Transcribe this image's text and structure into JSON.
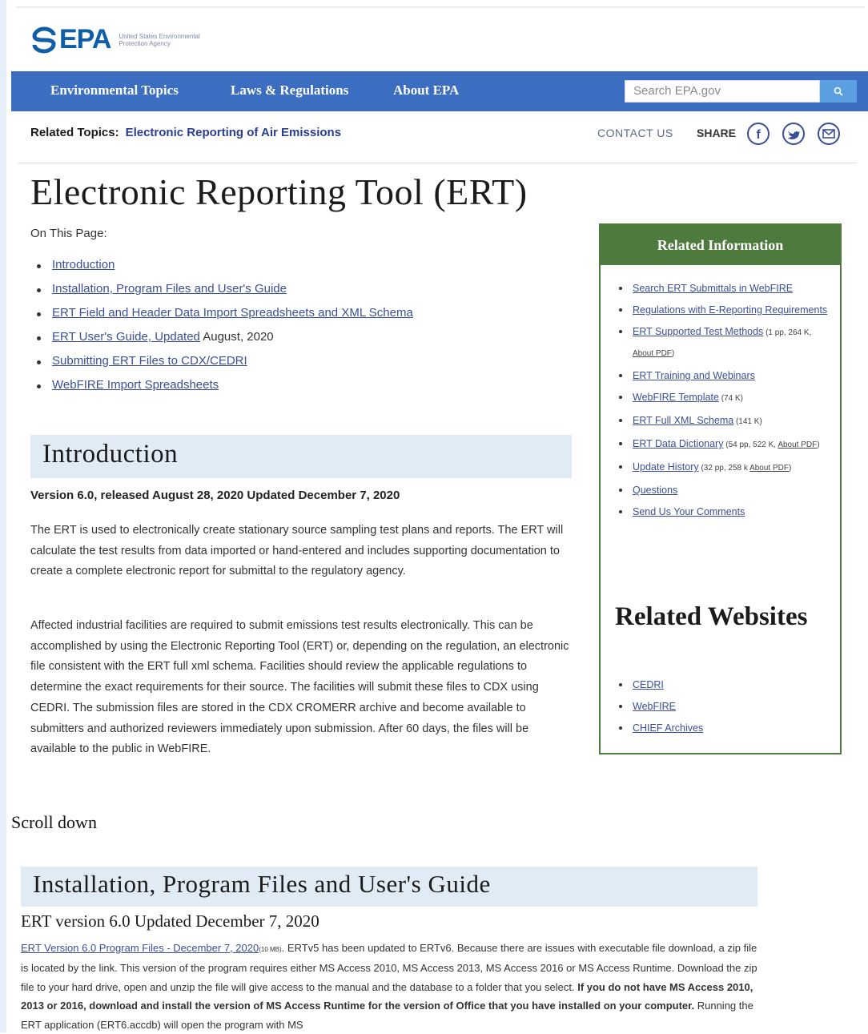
{
  "header": {
    "logo_text": "EPA",
    "logo_subtitle": "United States Environmental Protection Agency"
  },
  "nav": {
    "items": [
      {
        "label": "Environmental Topics"
      },
      {
        "label": "Laws & Regulations"
      },
      {
        "label": "About EPA"
      }
    ],
    "search_placeholder": "Search EPA.gov",
    "accent_color": "#3b6dc0"
  },
  "related_topics": {
    "label": "Related Topics:",
    "link": "Electronic Reporting of Air Emissions"
  },
  "utility": {
    "contact": "CONTACT US",
    "share": "SHARE",
    "icons": [
      "facebook-icon",
      "twitter-icon",
      "email-icon"
    ]
  },
  "page": {
    "title": "Electronic Reporting Tool (ERT)",
    "on_this_page": "On This Page:",
    "toc": [
      {
        "link": "Introduction",
        "suffix": ""
      },
      {
        "link": "Installation, Program Files and User's Guide",
        "suffix": ""
      },
      {
        "link": "ERT Field and Header Data Import Spreadsheets and XML Schema",
        "suffix": ""
      },
      {
        "link": "ERT User's Guide, Updated",
        "suffix": " August, 2020"
      },
      {
        "link": "Submitting ERT Files to CDX/CEDRI",
        "suffix": ""
      },
      {
        "link": "WebFIRE Import Spreadsheets",
        "suffix": ""
      }
    ]
  },
  "intro": {
    "heading": "Introduction",
    "version": "Version 6.0, released August 28, 2020 Updated December 7, 2020",
    "para1": "The ERT is used to electronically create stationary source sampling test plans and reports. The ERT will calculate the test results from data imported or hand-entered and includes supporting documentation to create a complete electronic report for submittal to the regulatory agency.",
    "para2": "Affected industrial facilities are required to submit emissions test results electronically. This can be accomplished by using the Electronic Reporting Tool (ERT) or, depending on the regulation, an electronic file consistent with the ERT full xml schema. Facilities should review the applicable regulations to determine the exact requirements for their source. The facilities will submit these files to CDX using CEDRI. The submission files are stored in the CDX CROMERR archive and become available to submitters and authorized reviewers immediately upon submission. After 60 days, the files will be available to the public in WebFIRE."
  },
  "scroll_note": "Scroll down",
  "install": {
    "heading": "Installation, Program Files and User's Guide",
    "subheading": "ERT version 6.0 Updated December 7, 2020",
    "link": "ERT Version 6.0 Program Files - December 7, 2020",
    "size": "(10 MB)",
    "text1": ". ERTv5 has been updated to ERTv6. Because there are issues with executable file download, a zip file is located by the link. This version of the program requires either MS Access 2010, MS Access 2013, MS Access 2016 or MS Access Runtime. Download the zip file to your hard drive, open and unzip the file will give access to the manual and the database to a folder that you select. ",
    "bold": "If you do not have MS Access 2010, 2013 or 2016, download and install the version of MS Access Runtime for the version of Office that you have installed on your computer.",
    "text2": " Running the ERT application (ERT6.accdb) will open the program with MS"
  },
  "sidebar": {
    "heading": "Related Information",
    "items": [
      {
        "link": "Search ERT Submittals in WebFIRE",
        "meta": "",
        "link2": ""
      },
      {
        "link": "Regulations with E-Reporting Requirements",
        "meta": "",
        "link2": ""
      },
      {
        "link": "ERT Supported Test Methods",
        "meta": " (1 pp, 264 K, ",
        "link2": "About PDF",
        "close": ")"
      },
      {
        "link": "ERT Training and Webinars",
        "meta": "",
        "link2": ""
      },
      {
        "link": "WebFIRE Template",
        "meta": " (74 K)",
        "link2": ""
      },
      {
        "link": "ERT Full XML Schema",
        "meta": " (141 K)",
        "link2": ""
      },
      {
        "link": "ERT Data Dictionary",
        "meta": " (54 pp, 522 K, ",
        "link2": "About PDF",
        "close": ")"
      },
      {
        "link": "Update History",
        "meta": " (32 pp, 258 k ",
        "link2": "About PDF",
        "close": ")"
      },
      {
        "link": "Questions",
        "meta": "",
        "link2": ""
      },
      {
        "link": "Send Us Your Comments",
        "meta": "",
        "link2": ""
      }
    ],
    "related_websites_title": "Related Websites",
    "websites": [
      "CEDRI",
      "WebFIRE",
      "CHIEF Archives"
    ],
    "accent_color": "#4e7b3d"
  }
}
